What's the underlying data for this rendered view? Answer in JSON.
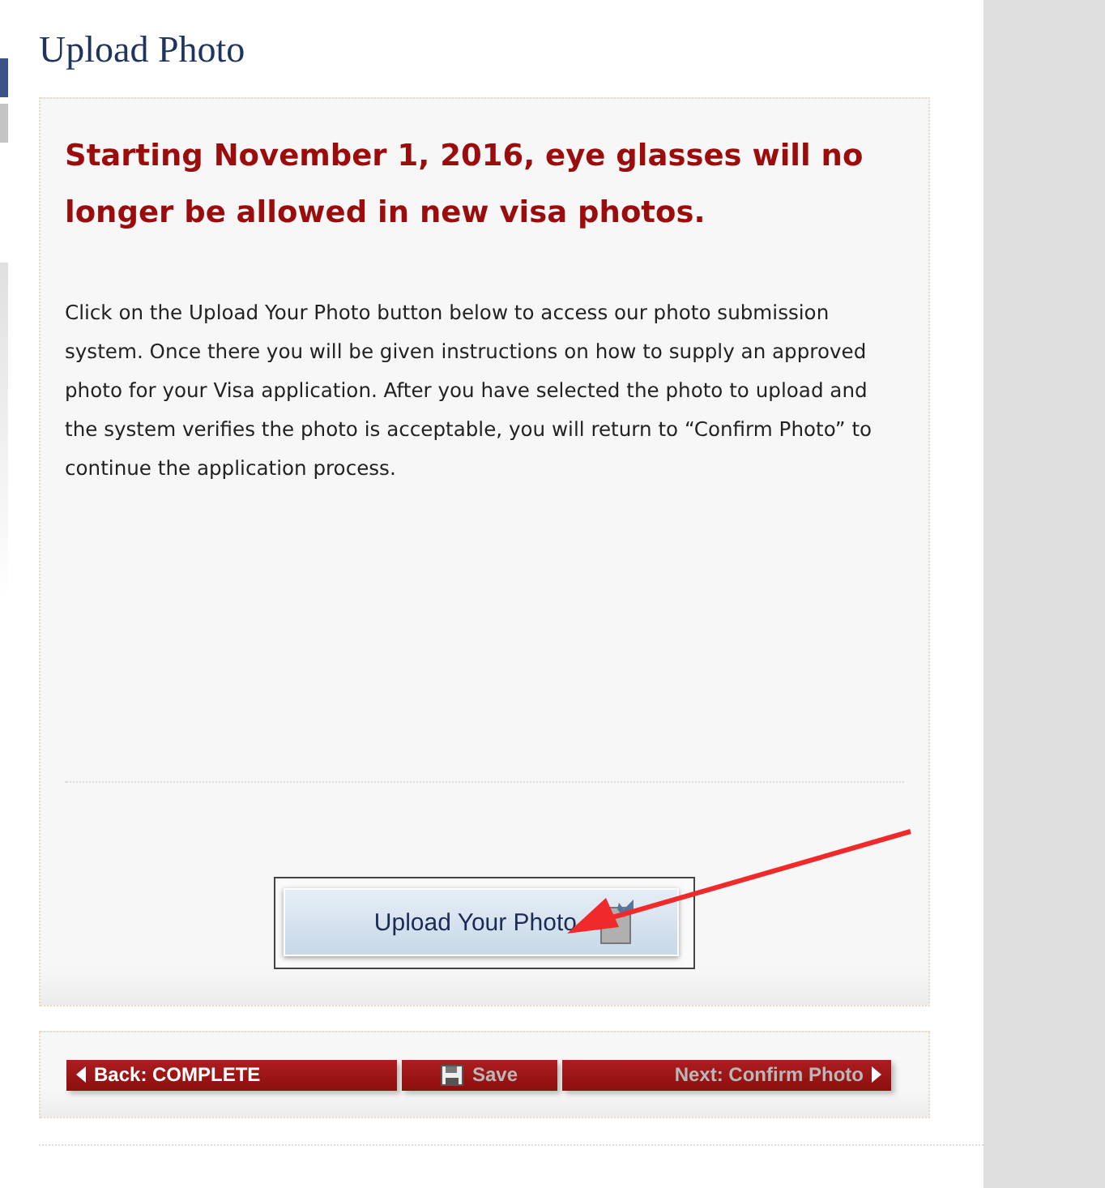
{
  "page_title": "Upload Photo",
  "notice": "Starting November 1, 2016, eye glasses will no longer be allowed in new visa photos.",
  "instructions": "Click on the Upload Your Photo button below to access our photo submission system. Once there you will be given instructions on how to supply an approved photo for your Visa application. After you have selected the photo to upload and the system verifies the photo is acceptable, you will return to “Confirm Photo” to continue the application process.",
  "upload_button": {
    "label": "Upload Your Photo"
  },
  "nav_buttons": [
    {
      "kind": "back",
      "label": "Back: COMPLETE",
      "disabled": false
    },
    {
      "kind": "save",
      "label": "Save",
      "disabled": true
    },
    {
      "kind": "next",
      "label": "Next: Confirm Photo",
      "disabled": true
    }
  ]
}
